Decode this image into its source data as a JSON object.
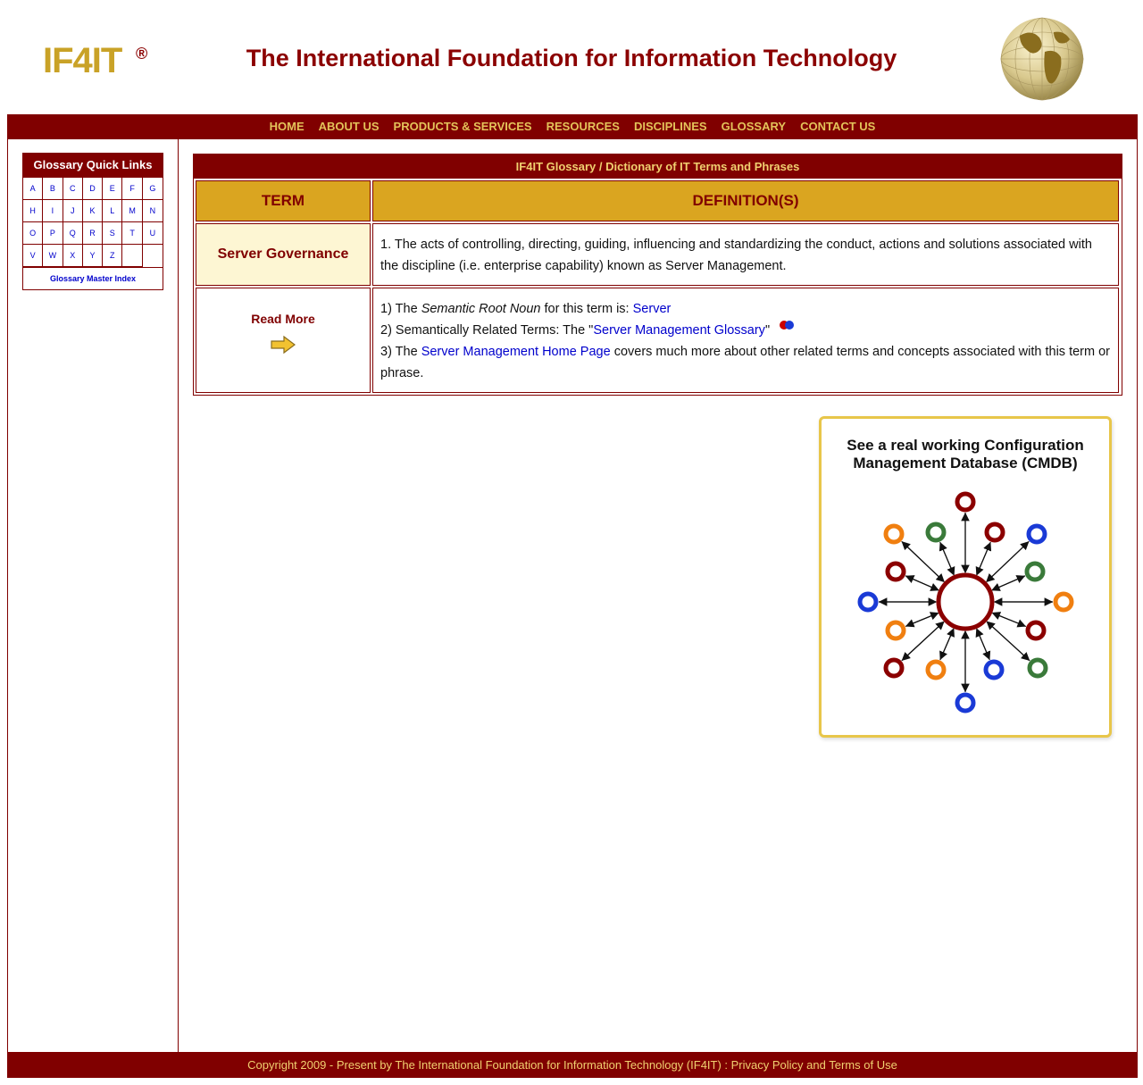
{
  "header": {
    "logo_text": "IF4IT",
    "logo_mark": "®",
    "title": "The International Foundation for Information Technology"
  },
  "nav": [
    "HOME",
    "ABOUT US",
    "PRODUCTS & SERVICES",
    "RESOURCES",
    "DISCIPLINES",
    "GLOSSARY",
    "CONTACT US"
  ],
  "quick_links": {
    "title": "Glossary Quick Links",
    "letters": [
      "A",
      "B",
      "C",
      "D",
      "E",
      "F",
      "G",
      "H",
      "I",
      "J",
      "K",
      "L",
      "M",
      "N",
      "O",
      "P",
      "Q",
      "R",
      "S",
      "T",
      "U",
      "V",
      "W",
      "X",
      "Y",
      "Z"
    ],
    "master_index": "Glossary Master Index"
  },
  "glossary": {
    "heading": "IF4IT Glossary / Dictionary of IT Terms and Phrases",
    "col_term": "TERM",
    "col_def": "DEFINITION(S)",
    "term": "Server Governance",
    "definition": "1. The acts of controlling, directing, guiding, influencing and standardizing the conduct, actions and solutions associated with the discipline (i.e. enterprise capability) known as Server Management.",
    "read_more": "Read More",
    "more": {
      "l1_prefix": "1) The ",
      "l1_em": "Semantic Root Noun",
      "l1_mid": " for this term is: ",
      "l1_link": "Server",
      "l2_prefix": "2) Semantically Related Terms: The \"",
      "l2_link": "Server Management Glossary",
      "l2_suffix": "\"",
      "l3_prefix": "3) The ",
      "l3_link": "Server Management Home Page",
      "l3_suffix": " covers much more about other related terms and concepts associated with this term or phrase."
    }
  },
  "cmdb_ad": {
    "line1": "See a real working Configuration",
    "line2": "Management Database (CMDB)"
  },
  "footer": {
    "text": "Copyright 2009 - Present by The International Foundation for Information Technology (IF4IT) : ",
    "link1": "Privacy Policy",
    "and": " and ",
    "link2": "Terms of Use"
  },
  "colors": {
    "brand": "#800000",
    "gold": "#daa520",
    "link": "#0000cc"
  }
}
